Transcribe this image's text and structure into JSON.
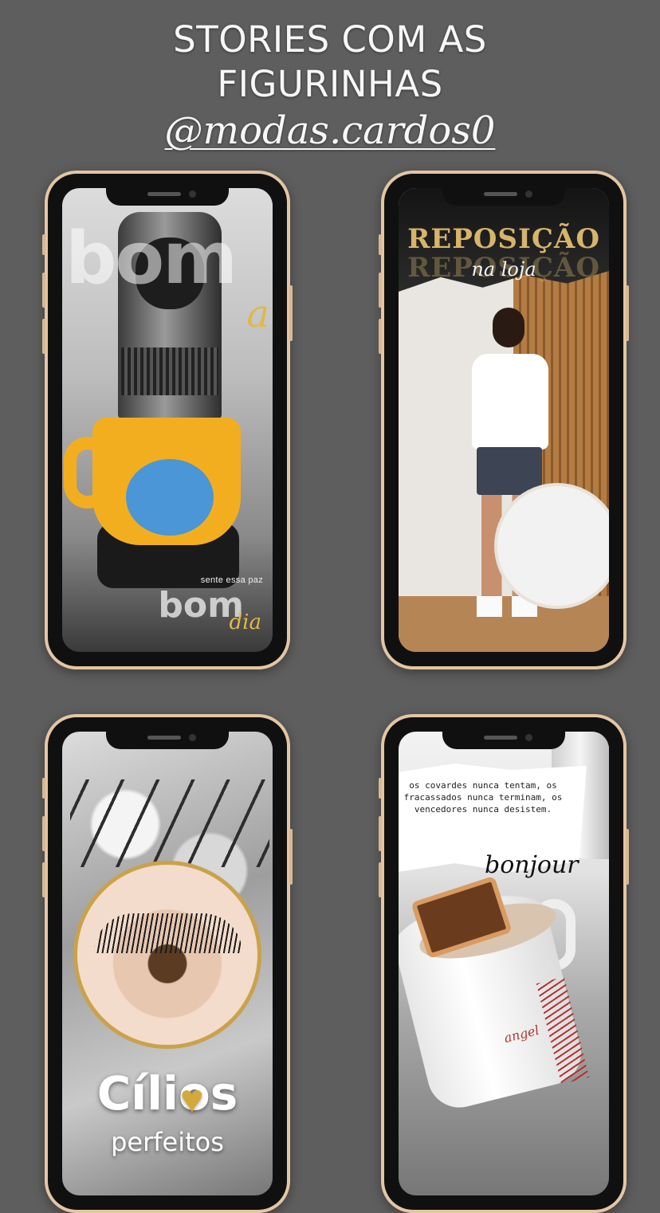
{
  "header": {
    "title_line1": "STORIES COM AS",
    "title_line2": "FIGURINHAS",
    "handle": "@modas.cardos0"
  },
  "colors": {
    "background": "#5e5e5e",
    "phone_frame": "#e4c6a4",
    "gold_accent": "#d6b46a"
  },
  "stories": [
    {
      "id": "bom-dia",
      "bg_word": "bom",
      "bg_script": "a",
      "caption_small": "sente essa paz",
      "caption_big": "bom",
      "caption_script": "dia"
    },
    {
      "id": "reposicao",
      "title": "REPOSIÇÃO",
      "title_shadow": "REPOSIÇÃO",
      "subtitle": "na loja"
    },
    {
      "id": "cilios",
      "title": "Cílios",
      "subtitle": "perfeitos",
      "icon": "heart-icon"
    },
    {
      "id": "bonjour",
      "quote": "os covardes nunca tentam, os fracassados nunca terminam, os vencedores nunca desistem.",
      "script": "bonjour",
      "cup_text": "angel"
    }
  ]
}
